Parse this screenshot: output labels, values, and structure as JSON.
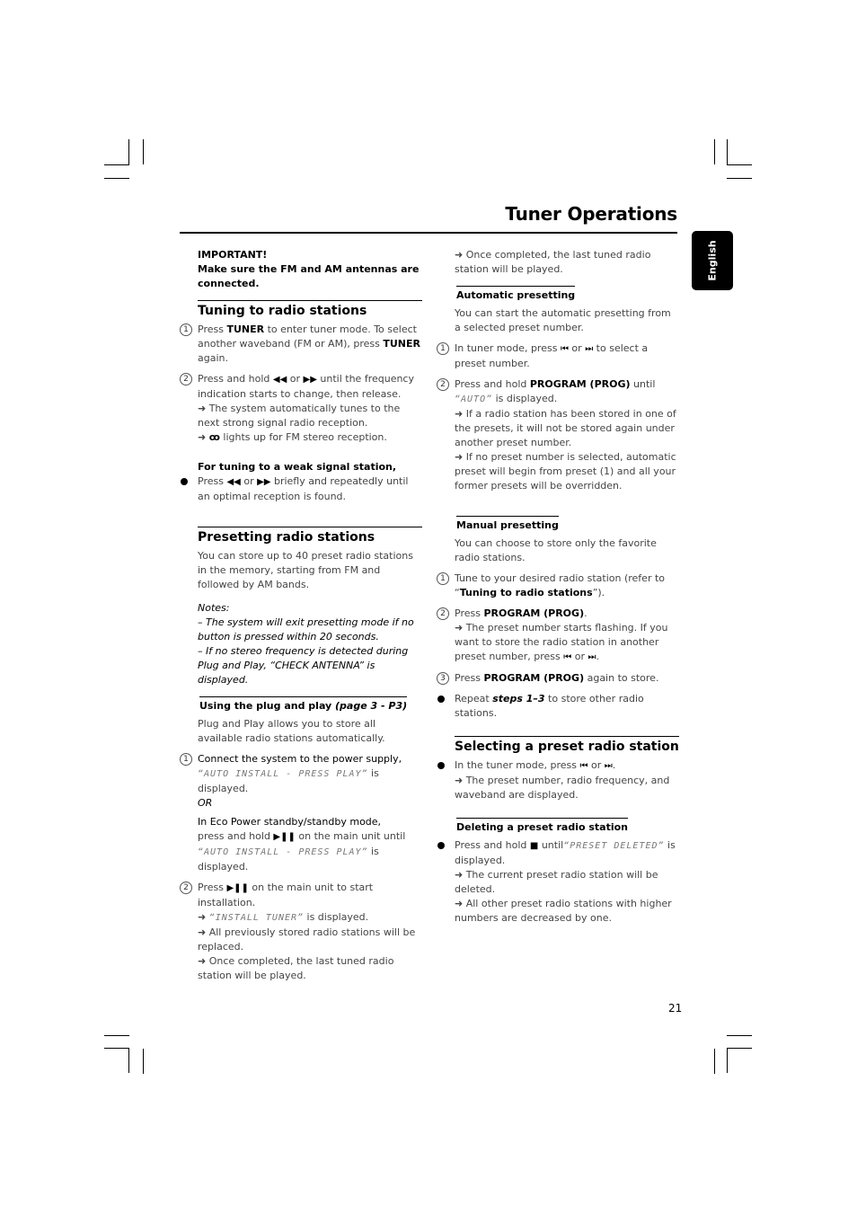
{
  "header": {
    "title": "Tuner Operations",
    "language_tab": "English"
  },
  "page_number": "21",
  "left": {
    "important_label": "IMPORTANT!",
    "important_text": "Make sure the FM and AM antennas are connected.",
    "tuning": {
      "heading": "Tuning to radio stations",
      "step1": {
        "pre": "Press ",
        "b1": "TUNER",
        "mid": " to enter tuner mode. To select another waveband (FM or AM), press ",
        "b2": "TUNER",
        "post": " again."
      },
      "step2": {
        "pre": "Press and hold ",
        "g1": "◀◀",
        "or": " or ",
        "g2": "▶▶",
        "post": " until the frequency indication starts to change, then release.",
        "arrow1": "➜ The system automatically tunes to the next strong signal radio reception.",
        "arrow2_pre": "➜ ",
        "stereo_icon": "ꝏ",
        "arrow2_post": " lights up for FM stereo reception."
      },
      "weak_heading": "For tuning to a weak signal station,",
      "weak": {
        "pre": "Press ",
        "g1": "◀◀",
        "or": " or ",
        "g2": "▶▶",
        "post": " briefly and repeatedly until an optimal reception is found."
      }
    },
    "presetting": {
      "heading": "Presetting radio stations",
      "intro": "You can store up to 40 preset radio stations in the memory, starting from FM and followed by AM bands.",
      "notes_label": "Notes:",
      "note1": "–  The system will exit presetting mode if no button is pressed within 20 seconds.",
      "note2": "–  If no stereo frequency is detected during Plug and Play, “CHECK ANTENNA” is displayed."
    },
    "plug_play": {
      "heading": "Using the plug and play ",
      "heading_ref": "(page 3 - P3)",
      "intro": "Plug and Play allows you to store all available radio stations automatically.",
      "step1_b": "Connect the system to the power supply,",
      "lcd1": "“AUTO INSTALL - PRESS PLAY”",
      "step1_post": " is displayed.",
      "or": "OR",
      "eco_b": "In Eco Power standby/standby mode,",
      "eco_pre": "press and hold ",
      "play_pause": "▶❚❚",
      "eco_post": " on the main unit until",
      "lcd2": "“AUTO INSTALL - PRESS PLAY”",
      "eco_end": " is displayed.",
      "step2_pre": "Press ",
      "step2_post": " on the main unit to start installation.",
      "arrow1_pre": "➜ ",
      "lcd3": "“INSTALL TUNER”",
      "arrow1_post": " is displayed.",
      "arrow2": "➜ All previously stored radio stations will be replaced.",
      "arrow3": "➜ Once completed, the last tuned radio station will be played."
    }
  },
  "right": {
    "cont": "➜ Once completed, the last tuned radio station will be played.",
    "auto": {
      "heading": "Automatic presetting",
      "intro": "You can start the automatic presetting from a selected preset number.",
      "step1_pre": "In tuner mode, press ",
      "prev": "⏮",
      "or": " or ",
      "next": "⏭",
      "step1_post": " to select a preset number.",
      "step2_pre": "Press and hold ",
      "step2_b": "PROGRAM (PROG)",
      "step2_mid": " until",
      "lcd": "“AUTO”",
      "step2_post": " is displayed.",
      "arrow1": "➜ If a radio station has been stored in one of the presets, it will not be stored again under another preset number.",
      "arrow2": "➜ If no preset number is selected, automatic preset will begin from preset (1) and all your former presets will be overridden."
    },
    "manual": {
      "heading": "Manual presetting",
      "intro": "You can choose to store only the favorite radio stations.",
      "step1_pre": "Tune to your desired radio station (refer to “",
      "step1_b": "Tuning to radio stations",
      "step1_post": "”).",
      "step2_pre": "Press ",
      "step2_b": "PROGRAM (PROG)",
      "step2_post": ".",
      "step2_arrow": "➜ The preset number starts flashing. If you want to store the radio station in another preset number, press ",
      "prev": "⏮",
      "or": " or ",
      "next": "⏭",
      "dot": ".",
      "step3_pre": "Press ",
      "step3_b": "PROGRAM (PROG)",
      "step3_post": " again to store.",
      "repeat_pre": "Repeat ",
      "repeat_b": "steps 1–3",
      "repeat_post": " to store other radio stations."
    },
    "selecting": {
      "heading": "Selecting a preset radio station",
      "pre": "In the tuner mode, press ",
      "prev": "⏮",
      "or": " or ",
      "next": "⏭",
      "post": ".",
      "arrow": "➜ The preset number, radio frequency, and waveband are displayed."
    },
    "deleting": {
      "heading": "Deleting a preset radio station",
      "pre": "Press and hold ",
      "stop": "■",
      "mid": " until",
      "lcd": "“PRESET DELETED”",
      "post": " is displayed.",
      "arrow1": "➜ The current preset radio station will be deleted.",
      "arrow2": "➜ All other preset radio stations with higher numbers are decreased by one."
    }
  }
}
